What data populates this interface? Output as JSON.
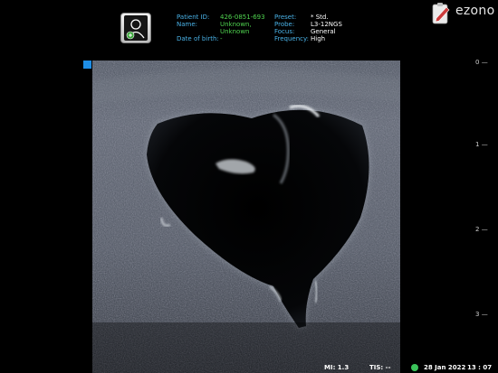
{
  "patient_info": {
    "labels": [
      "Patient ID:",
      "Name:",
      "",
      "Date of birth:"
    ],
    "values": [
      "426-0851-693",
      "Unknown,",
      "Unknown",
      "-"
    ]
  },
  "probe_info": {
    "labels": [
      "Preset:",
      "Probe:",
      "Focus:",
      "Frequency:"
    ],
    "values": [
      "* Std.",
      "L3-12NGS",
      "General",
      "High"
    ]
  },
  "logo": {
    "text": "ezono"
  },
  "depth_scale": {
    "ticks": [
      "0",
      "1",
      "2",
      "3"
    ]
  },
  "status": {
    "mi_label": "MI: 1.3",
    "tis_label": "TIS: --",
    "date": "28 Jan 2022",
    "time": "13 : 07"
  },
  "icons": {
    "patient": "patient-icon",
    "logo": "clipboard-pen-icon",
    "status": "status-light-icon"
  },
  "colors": {
    "label": "#4ab3e8",
    "value": "#4fd34f",
    "marker": "#1e8ee6",
    "background": "#000000"
  }
}
